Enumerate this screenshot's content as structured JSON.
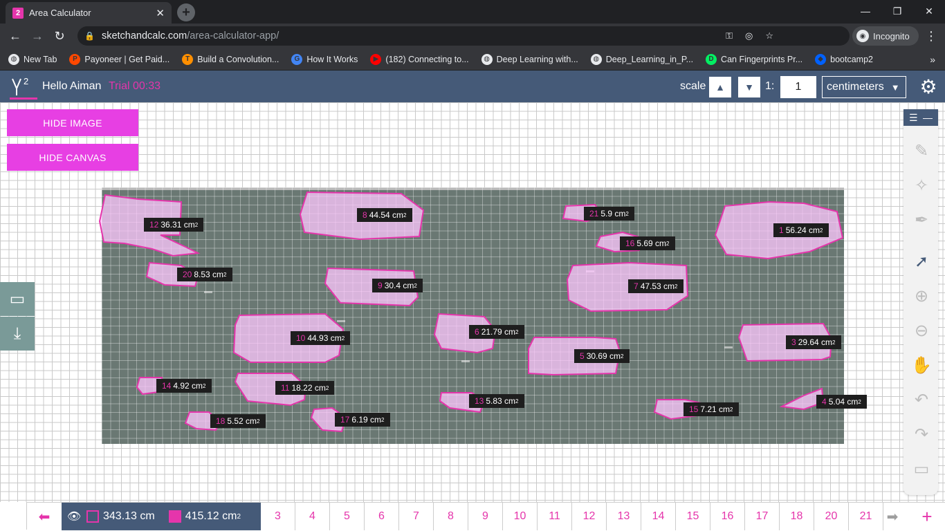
{
  "browser": {
    "tab_title": "Area Calculator",
    "tab_favicon": "2",
    "url_host": "sketchandcalc.com",
    "url_path": "/area-calculator-app/",
    "incognito_label": "Incognito",
    "bookmarks": [
      {
        "label": "New Tab",
        "icon": "globe-icon",
        "color": "#e8eaed"
      },
      {
        "label": "Payoneer | Get Paid...",
        "icon": "payoneer-icon",
        "color": "#ff4800"
      },
      {
        "label": "Build a Convolution...",
        "icon": "tensorflow-icon",
        "color": "#ff8f00"
      },
      {
        "label": "How It Works",
        "icon": "google-icon",
        "color": "#4285f4"
      },
      {
        "label": "(182) Connecting to...",
        "icon": "youtube-icon",
        "color": "#ff0000"
      },
      {
        "label": "Deep Learning with...",
        "icon": "globe-icon",
        "color": "#e8eaed"
      },
      {
        "label": "Deep_Learning_in_P...",
        "icon": "globe-icon",
        "color": "#e8eaed"
      },
      {
        "label": "Can Fingerprints Pr...",
        "icon": "datacamp-icon",
        "color": "#03ef62"
      },
      {
        "label": "bootcamp2",
        "icon": "dropbox-icon",
        "color": "#0061ff"
      }
    ]
  },
  "header": {
    "greeting": "Hello Aiman",
    "trial": "Trial 00:33",
    "scale_label": "scale",
    "ratio_label": "1:",
    "ratio_value": "1",
    "unit": "centimeters"
  },
  "buttons": {
    "hide_image": "HIDE IMAGE",
    "hide_canvas": "HIDE CANVAS"
  },
  "shapes": [
    {
      "num": "1",
      "value": "56.24 cm",
      "sup": "2"
    },
    {
      "num": "3",
      "value": "29.64 cm",
      "sup": "2"
    },
    {
      "num": "4",
      "value": "5.04 cm",
      "sup": "2"
    },
    {
      "num": "5",
      "value": "30.69 cm",
      "sup": "2"
    },
    {
      "num": "6",
      "value": "21.79 cm",
      "sup": "2"
    },
    {
      "num": "7",
      "value": "47.53 cm",
      "sup": "2"
    },
    {
      "num": "8",
      "value": "44.54 cm",
      "sup": "2"
    },
    {
      "num": "9",
      "value": "30.4 cm",
      "sup": "2"
    },
    {
      "num": "10",
      "value": "44.93 cm",
      "sup": "2"
    },
    {
      "num": "11",
      "value": "18.22 cm",
      "sup": "2"
    },
    {
      "num": "12",
      "value": "36.31 cm",
      "sup": "2"
    },
    {
      "num": "13",
      "value": "5.83 cm",
      "sup": "2"
    },
    {
      "num": "14",
      "value": "4.92 cm",
      "sup": "2"
    },
    {
      "num": "15",
      "value": "7.21 cm",
      "sup": "2"
    },
    {
      "num": "16",
      "value": "5.69 cm",
      "sup": "2"
    },
    {
      "num": "17",
      "value": "6.19 cm",
      "sup": "2"
    },
    {
      "num": "18",
      "value": "5.52 cm",
      "sup": "2"
    },
    {
      "num": "20",
      "value": "8.53 cm",
      "sup": "2"
    },
    {
      "num": "21",
      "value": "5.9 cm",
      "sup": "2"
    }
  ],
  "summary": {
    "perimeter": "343.13 cm",
    "area": "415.12 cm",
    "area_sup": "2"
  },
  "pages": [
    "3",
    "4",
    "5",
    "6",
    "7",
    "8",
    "9",
    "10",
    "11",
    "12",
    "13",
    "14",
    "15",
    "16",
    "17",
    "18",
    "20",
    "21"
  ],
  "pages_note_hidden": "",
  "colors": {
    "accent": "#e535ab",
    "header_bg": "#455a78",
    "button_pink": "#e73fe3"
  }
}
